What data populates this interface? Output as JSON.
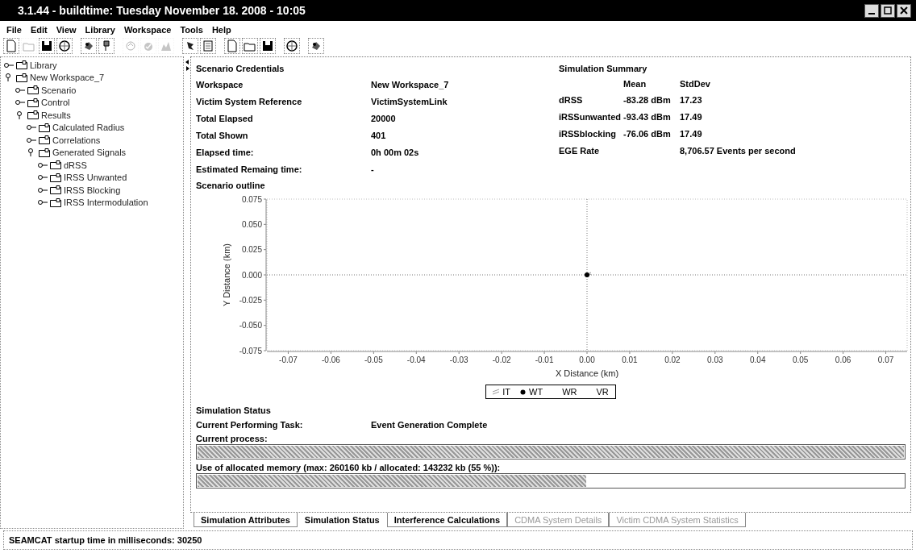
{
  "window": {
    "title": "3.1.44 - buildtime: Tuesday November 18. 2008 - 10:05"
  },
  "menu": [
    {
      "label": "File"
    },
    {
      "label": "Edit"
    },
    {
      "label": "View"
    },
    {
      "label": "Library"
    },
    {
      "label": "Workspace"
    },
    {
      "label": "Tools"
    },
    {
      "label": "Help"
    }
  ],
  "toolbar": [
    [
      {
        "disabled": false
      },
      {
        "disabled": true
      },
      {
        "disabled": false
      },
      {
        "disabled": false
      }
    ],
    [
      {
        "disabled": false
      },
      {
        "disabled": false
      }
    ],
    [
      {
        "disabled": true
      },
      {
        "disabled": true
      },
      {
        "disabled": true
      }
    ],
    [
      {
        "disabled": false
      },
      {
        "disabled": false
      }
    ],
    [
      {
        "disabled": false
      },
      {
        "disabled": false
      },
      {
        "disabled": false
      }
    ],
    [
      {
        "disabled": false
      }
    ],
    [
      {
        "disabled": false
      }
    ]
  ],
  "tree": [
    {
      "label": "Library",
      "expanded": false
    },
    {
      "label": "New Workspace_7",
      "expanded": true,
      "children": [
        {
          "label": "Scenario",
          "expanded": false
        },
        {
          "label": "Control",
          "expanded": false
        },
        {
          "label": "Results",
          "expanded": true,
          "children": [
            {
              "label": "Calculated Radius",
              "expanded": false
            },
            {
              "label": "Correlations",
              "expanded": false
            },
            {
              "label": "Generated Signals",
              "expanded": true,
              "children": [
                {
                  "label": "dRSS",
                  "expanded": false
                },
                {
                  "label": "IRSS Unwanted",
                  "expanded": false
                },
                {
                  "label": "IRSS Blocking",
                  "expanded": false
                },
                {
                  "label": "IRSS Intermodulation",
                  "expanded": false
                }
              ]
            }
          ]
        }
      ]
    }
  ],
  "credentials": {
    "title": "Scenario Credentials",
    "rows": [
      {
        "label": "Workspace",
        "value": "New Workspace_7"
      },
      {
        "label": "Victim System Reference",
        "value": "VictimSystemLink"
      },
      {
        "label": "Total Elapsed",
        "value": "20000"
      },
      {
        "label": "Total Shown",
        "value": "401"
      },
      {
        "label": "Elapsed time:",
        "value": "0h 00m 02s"
      },
      {
        "label": "Estimated Remaing time:",
        "value": "-"
      }
    ]
  },
  "summary": {
    "title": "Simulation Summary",
    "columns": [
      "Mean",
      "StdDev"
    ],
    "rows": [
      {
        "label": "dRSS",
        "mean": "-83.28 dBm",
        "stddev": "17.23"
      },
      {
        "label": "iRSSunwanted",
        "mean": "-93.43 dBm",
        "stddev": "17.49"
      },
      {
        "label": "iRSSblocking",
        "mean": "-76.06 dBm",
        "stddev": "17.49"
      }
    ],
    "rate_label": "EGE Rate",
    "rate_value": "8,706.57 Events per second"
  },
  "outline": {
    "title": "Scenario outline",
    "chart_data": {
      "type": "scatter",
      "xlabel": "X Distance (km)",
      "ylabel": "Y Distance (km)",
      "x": [
        0
      ],
      "series": [
        {
          "name": "IT",
          "color": "#999999",
          "values": [
            0
          ]
        },
        {
          "name": "WT",
          "color": "#000000",
          "values": [
            0
          ]
        },
        {
          "name": "WR",
          "values": [
            null
          ]
        },
        {
          "name": "VR",
          "values": [
            null
          ]
        }
      ],
      "xlim": [
        -0.075,
        0.075
      ],
      "ylim": [
        -0.075,
        0.075
      ],
      "xticks": [
        {
          "value": -0.07,
          "label": "-0.07"
        },
        {
          "value": -0.06,
          "label": "-0.06"
        },
        {
          "value": -0.05,
          "label": "-0.05"
        },
        {
          "value": -0.04,
          "label": "-0.04"
        },
        {
          "value": -0.03,
          "label": "-0.03"
        },
        {
          "value": -0.02,
          "label": "-0.02"
        },
        {
          "value": -0.01,
          "label": "-0.01"
        },
        {
          "value": 0,
          "label": "0.00"
        },
        {
          "value": 0.01,
          "label": "0.01"
        },
        {
          "value": 0.02,
          "label": "0.02"
        },
        {
          "value": 0.03,
          "label": "0.03"
        },
        {
          "value": 0.04,
          "label": "0.04"
        },
        {
          "value": 0.05,
          "label": "0.05"
        },
        {
          "value": 0.06,
          "label": "0.06"
        },
        {
          "value": 0.07,
          "label": "0.07"
        }
      ],
      "yticks": [
        {
          "value": 0.075,
          "label": "0.075"
        },
        {
          "value": 0.05,
          "label": "0.050"
        },
        {
          "value": 0.025,
          "label": "0.025"
        },
        {
          "value": 0,
          "label": "0.000"
        },
        {
          "value": -0.025,
          "label": "-0.025"
        },
        {
          "value": -0.05,
          "label": "-0.050"
        },
        {
          "value": -0.075,
          "label": "-0.075"
        }
      ]
    }
  },
  "status": {
    "title": "Simulation Status",
    "task_label": "Current Performing Task:",
    "task_value": "Event Generation Complete",
    "process": {
      "label": "Current process:",
      "level": 1.0
    },
    "memory": {
      "label": "Use of allocated memory (max: 260160 kb / allocated: 143232 kb (55 %)):",
      "level": 0.55
    }
  },
  "tabs": [
    {
      "label": "Simulation Attributes",
      "selected": false,
      "disabled": false
    },
    {
      "label": "Simulation Status",
      "selected": true,
      "disabled": false
    },
    {
      "label": "Interference Calculations",
      "selected": false,
      "disabled": false
    },
    {
      "label": "CDMA System Details",
      "selected": false,
      "disabled": true
    },
    {
      "label": "Victim CDMA System Statistics",
      "selected": false,
      "disabled": true
    }
  ],
  "status_bar": "SEAMCAT startup time in milliseconds: 30250"
}
